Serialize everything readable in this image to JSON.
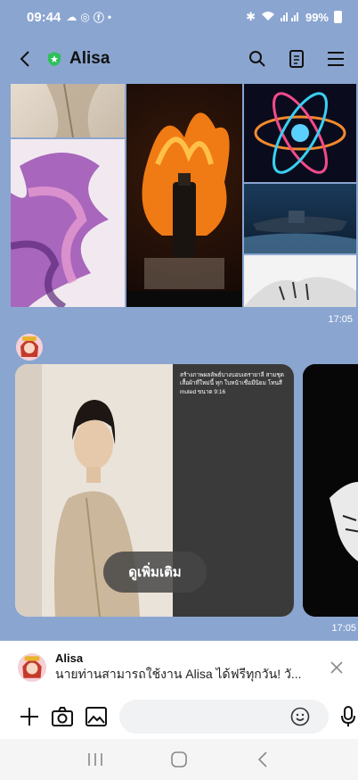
{
  "status_bar": {
    "time": "09:44",
    "battery": "99%"
  },
  "header": {
    "title": "Alisa"
  },
  "messages": {
    "grid_time": "17:05",
    "card_prompt": "สร้างภาพผลลัพธ์บางบอบเตรายาลี สามชุด เสื้อผ้าที่ใหม่นี้ ทุก ใบหน้าเชื่อมีนิยม โทนสี muted ขนาด 9:16",
    "see_more_label": "ดูเพิ่มเติม",
    "card_time": "17:05"
  },
  "notice": {
    "name": "Alisa",
    "message": "นายท่านสามารถใช้งาน Alisa ได้ฟรีทุกวัน! วั..."
  },
  "input": {
    "placeholder": ""
  }
}
